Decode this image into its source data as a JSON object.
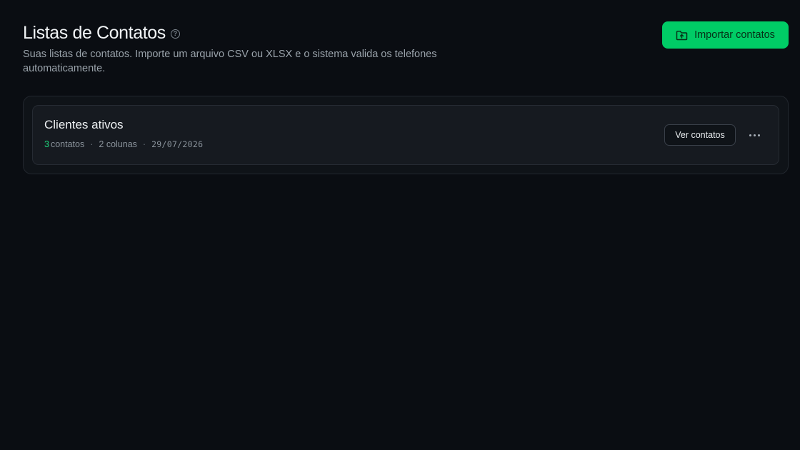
{
  "header": {
    "title": "Listas de Contatos",
    "help_icon": "help-circle-icon",
    "subtitle": "Suas listas de contatos. Importe um arquivo CSV ou XLSX e o sistema valida os telefones automaticamente.",
    "import_button": {
      "label": "Importar contatos",
      "icon": "folder-upload-icon"
    }
  },
  "lists": [
    {
      "name": "Clientes ativos",
      "count": "3",
      "count_label": "contatos",
      "separator": "·",
      "columns": "2 colunas",
      "date": "29/07/2026",
      "view_button": "Ver contatos",
      "more_icon": "more-horizontal-icon"
    }
  ],
  "colors": {
    "background": "#0a0d12",
    "accent": "#00cc66",
    "count": "#1ed47a"
  }
}
